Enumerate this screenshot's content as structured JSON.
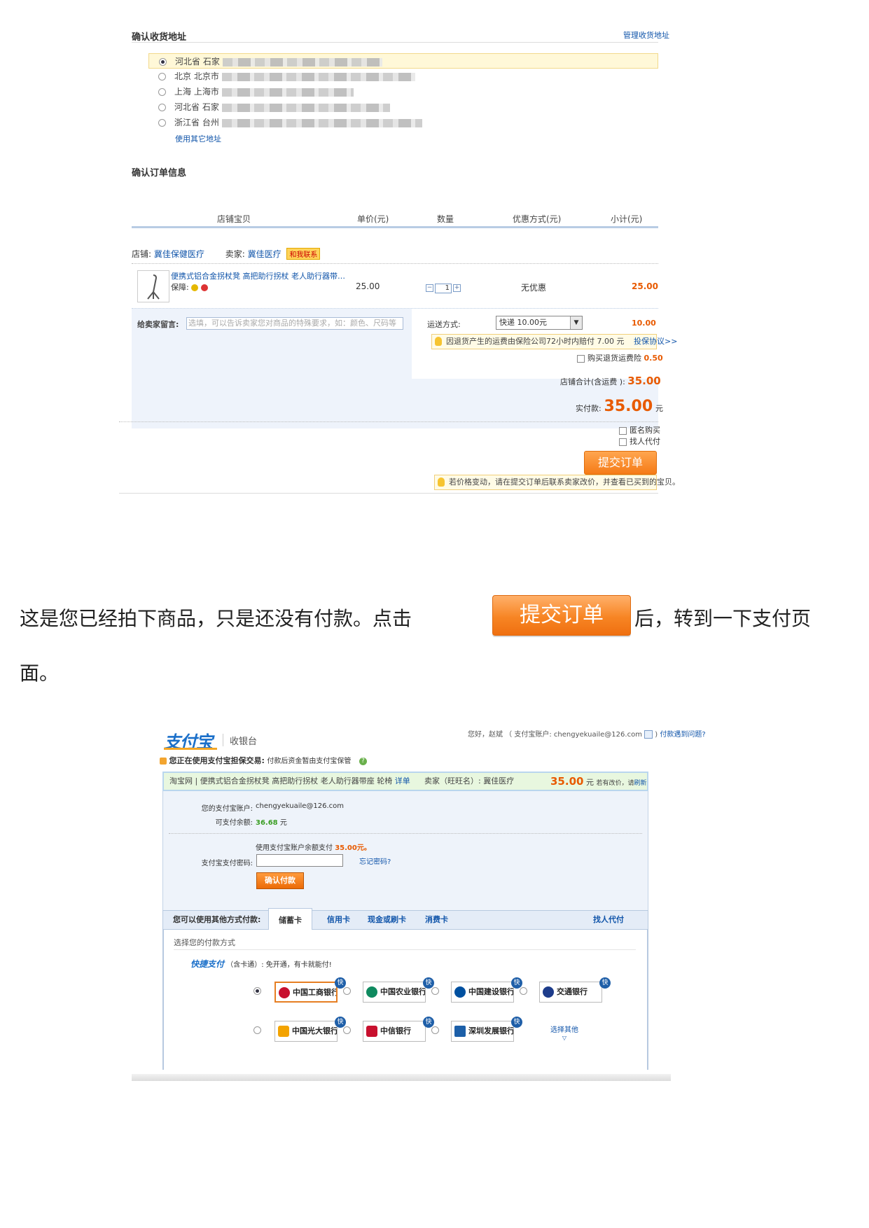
{
  "order_page": {
    "address_section_title": "确认收货地址",
    "manage_addresses": "管理收货地址",
    "addresses": [
      {
        "text": "河北省 石家",
        "selected": true
      },
      {
        "text": "北京 北京市",
        "selected": false
      },
      {
        "text": "上海 上海市",
        "selected": false
      },
      {
        "text": "河北省 石家",
        "selected": false
      },
      {
        "text": "浙江省 台州",
        "selected": false
      }
    ],
    "use_other_address": "使用其它地址",
    "order_section_title": "确认订单信息",
    "columns": [
      "店铺宝贝",
      "单价(元)",
      "数量",
      "优惠方式(元)",
      "小计(元)"
    ],
    "shop_label": "店铺:",
    "shop_name": "冀佳保健医疗",
    "seller_label": "卖家:",
    "seller_name": "冀佳医疗",
    "contact_label": "和我联系",
    "item_title": "便携式铝合金拐杖凳 高把助行拐杖 老人助行器带…",
    "guarantee_label": "保障:",
    "unit_price": "25.00",
    "quantity": "1",
    "discount": "无优惠",
    "subtotal": "25.00",
    "remark_label": "给卖家留言:",
    "remark_placeholder": "选填，可以告诉卖家您对商品的特殊要求，如：颜色、尺码等",
    "shipping_label": "运送方式:",
    "shipping_option": "快递 10.00元",
    "shipping_fee": "10.00",
    "insurance_tip": "因退货产生的运费由保险公司72小时内赔付 7.00 元",
    "insurance_link": "投保协议>>",
    "buy_insurance_label": "购买退货运费险",
    "insurance_price": "0.50",
    "shop_total_label": "店铺合计(含运费 ):",
    "shop_total": "35.00",
    "pay_label": "实付款:",
    "pay_amount": "35.00",
    "currency": "元",
    "anonymous_label": "匿名购买",
    "proxy_label": "找人代付",
    "submit_label": "提交订单",
    "price_tip": "若价格变动，请在提交订单后联系卖家改价，并查看已买到的宝贝。"
  },
  "caption": {
    "line1_before": "这是您已经拍下商品，只是还没有付款。点击",
    "button_label": "提交订单",
    "line1_after": "后，转到一下支付页",
    "line2": "面。"
  },
  "alipay": {
    "logo": "支付宝",
    "cashier_label": "收银台",
    "greeting": "您好，赵斌 （ 支付宝账户: chengyekuaile@126.com",
    "problem_link": "付款遇到问题?",
    "guarantee_title": "您正在使用支付宝担保交易:",
    "guarantee_desc": "付款后资金暂由支付宝保管",
    "order_source": "淘宝网",
    "order_item": "便携式铝合金拐杖凳 高把助行拐杖 老人助行器带座 轮椅",
    "detail_link": "详单",
    "seller_label": "卖家（旺旺名）:",
    "seller_name": "冀佳医疗",
    "amount": "35.00",
    "amount_unit": "元",
    "price_change_text": "若有改价，请",
    "refresh_link": "刷新",
    "account_label": "您的支付宝账户:",
    "account": "chengyekuaile@126.com",
    "balance_label": "可支付余额:",
    "balance": "36.68",
    "balance_unit": "元",
    "use_balance_text": "使用支付宝账户余额支付",
    "use_balance_amount": "35.00元。",
    "password_label": "支付宝支付密码:",
    "forgot_password": "忘记密码?",
    "confirm_button": "确认付款",
    "other_methods_label": "您可以使用其他方式付款:",
    "tabs": [
      "储蓄卡",
      "信用卡",
      "现金或刷卡",
      "消费卡"
    ],
    "proxy_pay": "找人代付",
    "choose_method": "选择您的付款方式",
    "quick_pay": "快捷支付",
    "quick_pay_note": "（含卡通）: 免开通，有卡就能付!",
    "banks": [
      "中国工商银行",
      "中国农业银行",
      "中国建设银行",
      "交通银行",
      "中国光大银行",
      "中信银行",
      "深圳发展银行"
    ],
    "more_banks": "选择其他",
    "quick_badge": "快"
  },
  "colors": {
    "orange": "#e85a00",
    "link_blue": "#1155aa",
    "alipay_blue": "#1a6fc9",
    "green_amount": "#3a9d23"
  }
}
